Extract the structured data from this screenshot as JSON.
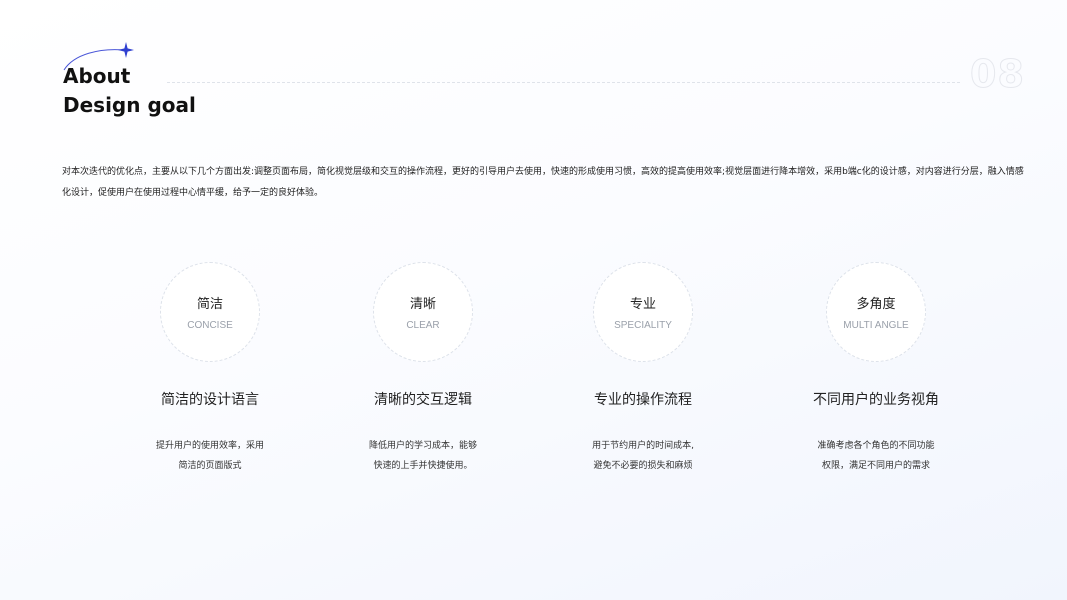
{
  "header": {
    "title_line1": "About",
    "title_line2": "Design goal",
    "page_number": "08"
  },
  "intro": {
    "line1": "对本次迭代的优化点，主要从以下几个方面出发:调整页面布局，简化视觉层级和交互的操作流程，更好的引导用户去使用，快速的形成使用习惯，高效的提高使用效率;视觉层面进行降本增效，采用b端c化的设计感，对内容进行分层，融入情感",
    "line2": "化设计，促使用户在使用过程中心情平缓，给予一定的良好体验。"
  },
  "cards": [
    {
      "cn": "简洁",
      "en": "CONCISE",
      "title": "简洁的设计语言",
      "desc1": "提升用户的使用效率，采用",
      "desc2": "简洁的页面版式"
    },
    {
      "cn": "清晰",
      "en": "CLEAR",
      "title": "清晰的交互逻辑",
      "desc1": "降低用户的学习成本，能够",
      "desc2": "快速的上手并快捷使用。"
    },
    {
      "cn": "专业",
      "en": "SPECIALITY",
      "title": "专业的操作流程",
      "desc1": "用于节约用户的时间成本,",
      "desc2": "避免不必要的损失和麻烦"
    },
    {
      "cn": "多角度",
      "en": "MULTI ANGLE",
      "title": "不同用户的业务视角",
      "desc1": "准确考虑各个角色的不同功能",
      "desc2": "权限，满足不同用户的需求"
    }
  ],
  "colors": {
    "accent": "#2f3fd0",
    "muted_text": "#9aa0aa"
  }
}
